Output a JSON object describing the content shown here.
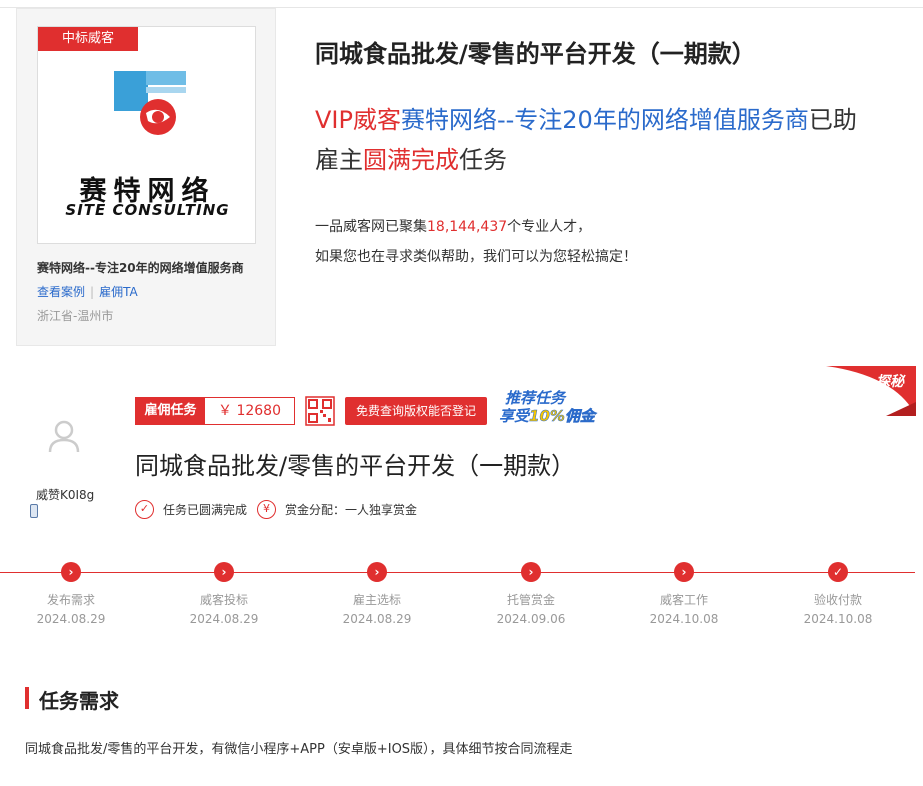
{
  "winner": {
    "tag": "中标威客",
    "logo_cn": "赛特网络",
    "logo_en": "SITE CONSULTING",
    "name": "赛特网络--专注20年的网络增值服务商",
    "link_cases": "查看案例",
    "link_hire": "雇佣TA",
    "location": "浙江省-温州市"
  },
  "headline": {
    "title": "同城食品批发/零售的平台开发（一期款）",
    "vip": "VIP威客",
    "company": "赛特网络--专注20年的网络增值服务商",
    "mid": "已助雇主",
    "done": "圆满完成",
    "end": "任务",
    "sub1_pre": "一品威客网已聚集",
    "talent_count": "18,144,437",
    "sub1_post": "个专业人才，",
    "sub2": "如果您也在寻求类似帮助，我们可以为您轻松搞定！"
  },
  "employer": {
    "username": "威赞K0I8g"
  },
  "task": {
    "price_label": "雇佣任务",
    "price_value": "￥ 12680",
    "query_button": "免费查询版权能否登记",
    "promo_line1": "推荐任务",
    "promo_line2_pre": "享受",
    "promo_line2_hl": "10%佣金",
    "title": "同城食品批发/零售的平台开发（一期款）",
    "status_done": "任务已圆满完成",
    "reward_split": "赏金分配：一人独享赏金",
    "ribbon": "探秘"
  },
  "timeline": [
    {
      "label": "发布需求",
      "date": "2024.08.29",
      "icon": "chevron-right-icon"
    },
    {
      "label": "威客投标",
      "date": "2024.08.29",
      "icon": "chevron-right-icon"
    },
    {
      "label": "雇主选标",
      "date": "2024.08.29",
      "icon": "chevron-right-icon"
    },
    {
      "label": "托管赏金",
      "date": "2024.09.06",
      "icon": "chevron-right-icon"
    },
    {
      "label": "威客工作",
      "date": "2024.10.08",
      "icon": "chevron-right-icon"
    },
    {
      "label": "验收付款",
      "date": "2024.10.08",
      "icon": "check-icon"
    }
  ],
  "requirements": {
    "title": "任务需求",
    "description": "同城食品批发/零售的平台开发，有微信小程序+APP（安卓版+IOS版），具体细节按合同流程走"
  },
  "colors": {
    "accent": "#e02f2f",
    "link": "#2a6acb"
  }
}
